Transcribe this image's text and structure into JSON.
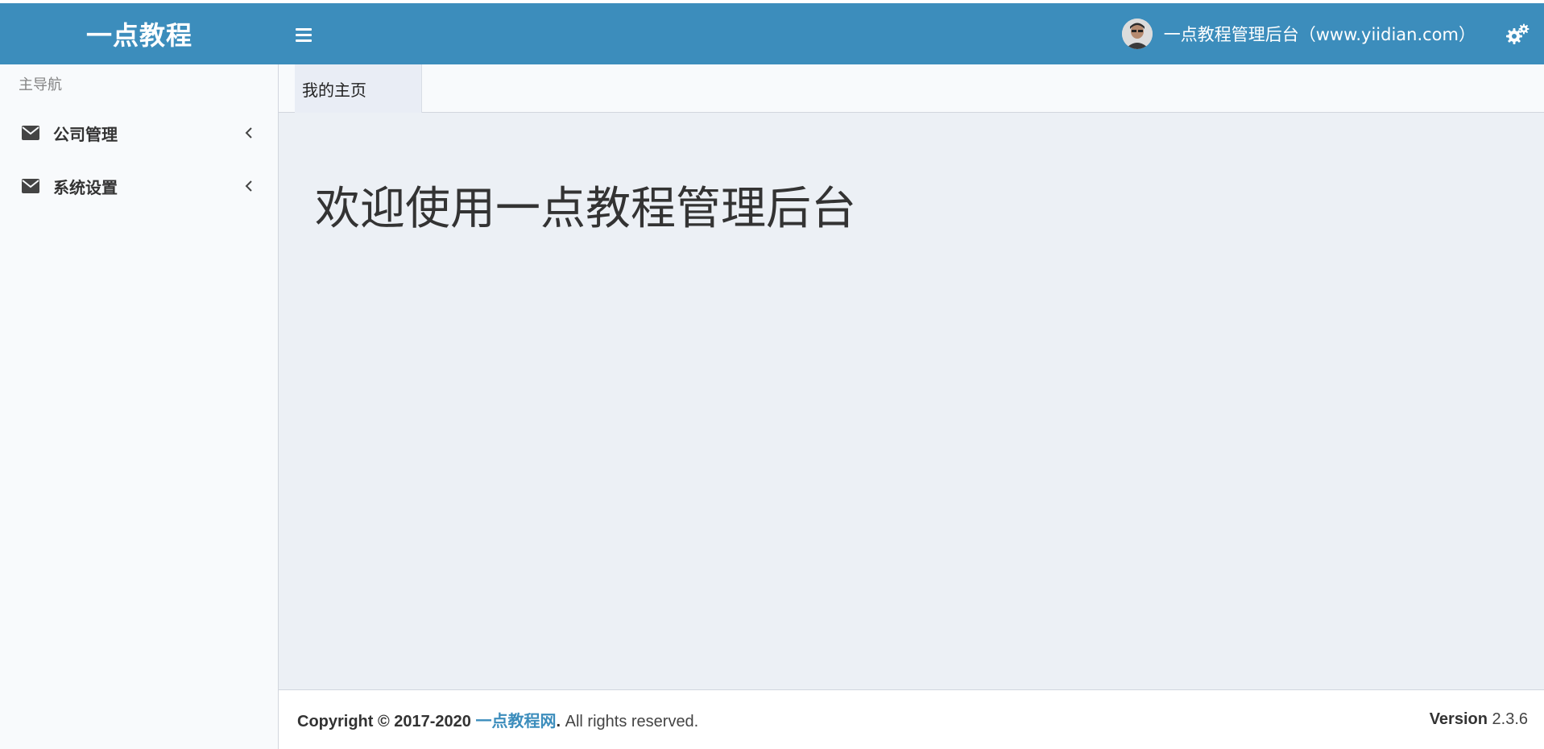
{
  "header": {
    "logo_text": "一点教程",
    "menu_toggle": "sidebar-toggle",
    "user_name": "一点教程管理后台（www.yiidian.com）",
    "settings_icon": "gears-icon",
    "bg_color": "#3c8dbc"
  },
  "sidebar": {
    "nav_header": "主导航",
    "items": [
      {
        "label": "公司管理",
        "icon": "envelope-icon"
      },
      {
        "label": "系统设置",
        "icon": "envelope-icon"
      }
    ]
  },
  "tabs": [
    {
      "label": "我的主页",
      "active": true
    }
  ],
  "main": {
    "welcome_title": "欢迎使用一点教程管理后台"
  },
  "footer": {
    "copyright_prefix": "Copyright © 2017-2020",
    "site_link": "一点教程网",
    "period": ".",
    "rights": "All rights reserved.",
    "version_label": "Version",
    "version_value": "2.3.6"
  }
}
